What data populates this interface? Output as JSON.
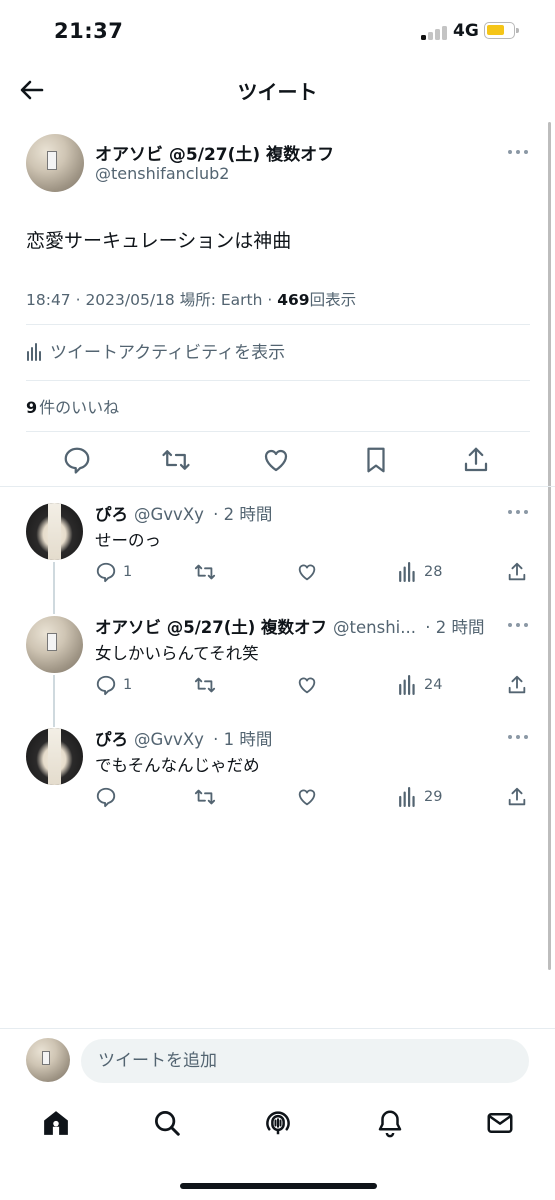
{
  "status_bar": {
    "time": "21:37",
    "network": "4G",
    "signal_bars_active": 1,
    "battery_color": "#f5c518"
  },
  "header": {
    "title": "ツイート",
    "back_icon": "arrow-left-icon"
  },
  "main_tweet": {
    "display_name": "オアソビ @5/27(土) 複数オフ",
    "handle": "@tenshifanclub2",
    "text": "恋愛サーキュレーションは神曲",
    "meta_prefix": "18:47 · 2023/05/18 場所: Earth · ",
    "views_count": "469",
    "views_label": "回表示",
    "activity_label": "ツイートアクティビティを表示",
    "likes_count": "9",
    "likes_label": "件のいいね",
    "actions": [
      "reply-icon",
      "retweet-icon",
      "like-icon",
      "bookmark-icon",
      "share-icon"
    ]
  },
  "replies": [
    {
      "display_name": "ぴろ",
      "handle": "@GvvXy",
      "time": "· 2 時間",
      "text": "せーのっ",
      "reply_count": "1",
      "views": "28"
    },
    {
      "display_name": "オアソビ @5/27(土) 複数オフ",
      "handle": "@tenshi...",
      "time": "· 2 時間",
      "text": "女しかいらんてそれ笑",
      "reply_count": "1",
      "views": "24"
    },
    {
      "display_name": "ぴろ",
      "handle": "@GvvXy",
      "time": "· 1 時間",
      "text": "でもそんなんじゃだめ",
      "reply_count": "",
      "views": "29"
    }
  ],
  "compose": {
    "placeholder": "ツイートを追加"
  },
  "tab_bar": {
    "tabs": [
      "home-icon",
      "search-icon",
      "spaces-icon",
      "notifications-icon",
      "messages-icon"
    ]
  },
  "colors": {
    "text": "#0f1419",
    "secondary": "#536471",
    "divider": "#e6ecf0",
    "input_bg": "#eff3f4"
  }
}
